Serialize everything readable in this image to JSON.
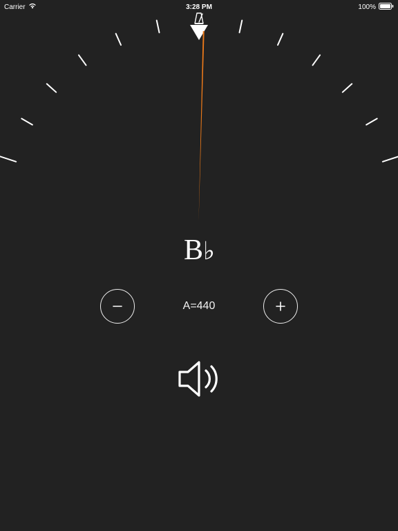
{
  "status_bar": {
    "carrier": "Carrier",
    "time": "3:28 PM",
    "battery": "100%"
  },
  "tuner": {
    "note_letter": "B",
    "note_accidental": "♭",
    "reference_label": "A=440",
    "needle_cents_offset": 1.5
  },
  "colors": {
    "background": "#222222",
    "needle": "#ed7a1a",
    "foreground": "#ffffff"
  },
  "dial": {
    "tick_angles_deg": [
      -72,
      -60,
      -48,
      -36,
      -24,
      -12,
      12,
      24,
      36,
      48,
      60,
      72
    ],
    "tick_major_every_end": true,
    "radius_px": 278
  }
}
